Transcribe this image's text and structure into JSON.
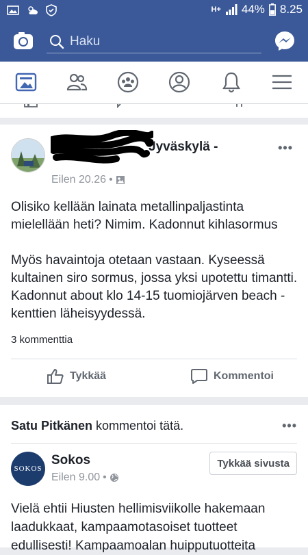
{
  "status_bar": {
    "network": "H+",
    "battery": "44%",
    "time": "8.25"
  },
  "search": {
    "placeholder": "Haku"
  },
  "post": {
    "author": "Jyväskylä -",
    "time": "Eilen 20.26",
    "paragraphs": [
      "Olisiko kellään lainata metallinpaljastinta mielellään heti? Nimim. Kadonnut kihlasormus",
      "Myös havaintoja otetaan vastaan. Kyseessä kultainen siro sormus, jossa yksi upotettu timantti. Kadonnut about klo 14-15 tuomiojärven beach -kenttien läheisyydessä."
    ],
    "comments_count": "3 kommenttia",
    "like_label": "Tykkää",
    "comment_label": "Kommentoi"
  },
  "shared": {
    "user": "Satu Pitkänen",
    "action": "kommentoi tätä.",
    "page_name": "Sokos",
    "page_logo_text": "SOKOS",
    "time": "Eilen 9.00",
    "like_page_label": "Tykkää sivusta",
    "text": "Vielä ehtii Hiusten hellimisviikolle hakemaan laadukkaat, kampaamotasoiset tuotteet edullisesti! Kampaamoalan huipputuotteita"
  },
  "colors": {
    "brand": "#3b5998",
    "accent": "#4267b2",
    "text": "#1d2129",
    "meta": "#90949c"
  }
}
